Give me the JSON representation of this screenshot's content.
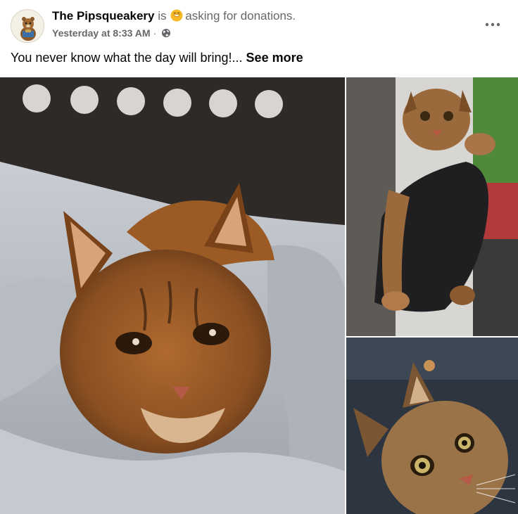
{
  "post": {
    "page_name": "The Pipsqueakery",
    "is_text": "is",
    "activity": "asking for donations.",
    "timestamp": "Yesterday at 8:33 AM",
    "separator": "·",
    "privacy_icon": "globe-icon",
    "activity_icon": "donation-smile-icon",
    "more_icon": "more-options-icon",
    "caption": "You never know what the day will bring!...",
    "see_more": "See more"
  },
  "photos": [
    {
      "subject": "bobcat kitten resting in grey blanket"
    },
    {
      "subject": "bobcat kitten held in black leather glove"
    },
    {
      "subject": "bobcat kitten in dark carrier"
    }
  ],
  "colors": {
    "text_primary": "#050505",
    "text_secondary": "#65676b",
    "donation_icon": "#f7b928"
  }
}
